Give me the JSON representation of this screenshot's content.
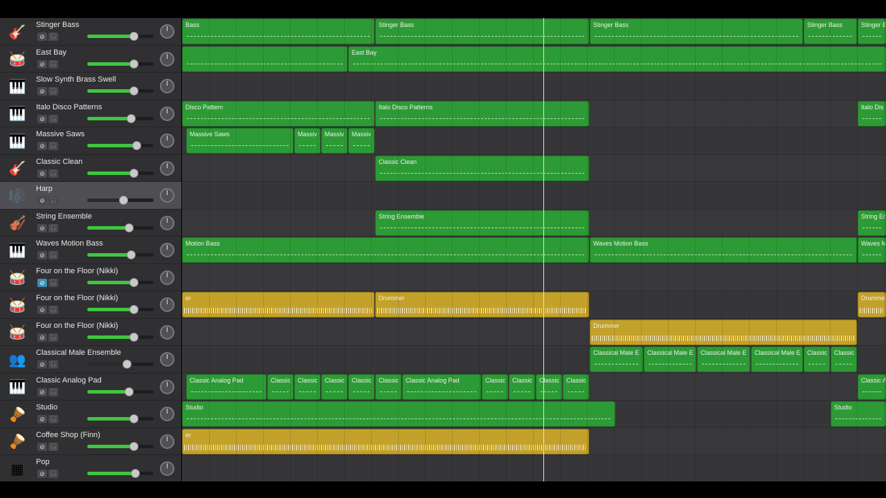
{
  "tracks": [
    {
      "name": "Stinger Bass",
      "icon": "bass-guitar-icon",
      "volume": 0.7,
      "mute": false
    },
    {
      "name": "East Bay",
      "icon": "drum-kit-icon",
      "volume": 0.7,
      "mute": false
    },
    {
      "name": "Slow Synth Brass Swell",
      "icon": "keyboard-icon",
      "volume": 0.7,
      "mute": false
    },
    {
      "name": "Italo Disco Patterns",
      "icon": "keyboard-stand-icon",
      "volume": 0.66,
      "mute": false
    },
    {
      "name": "Massive Saws",
      "icon": "keyboard-stand-icon",
      "volume": 0.74,
      "mute": false
    },
    {
      "name": "Classic Clean",
      "icon": "electric-guitar-icon",
      "volume": 0.7,
      "mute": false
    },
    {
      "name": "Harp",
      "icon": "harp-icon",
      "volume": 0.54,
      "mute": false,
      "selected": true
    },
    {
      "name": "String Ensemble",
      "icon": "violin-icon",
      "volume": 0.62,
      "mute": false
    },
    {
      "name": "Waves Motion Bass",
      "icon": "keyboard-stand-icon",
      "volume": 0.66,
      "mute": false
    },
    {
      "name": "Four on the Floor (Nikki)",
      "icon": "drum-machine-icon",
      "volume": 0.7,
      "mute": true
    },
    {
      "name": "Four on the Floor (Nikki)",
      "icon": "drum-machine-icon",
      "volume": 0.7,
      "mute": false
    },
    {
      "name": "Four on the Floor (Nikki)",
      "icon": "drum-machine-icon",
      "volume": 0.7,
      "mute": false
    },
    {
      "name": "Classical Male Ensemble",
      "icon": "choir-icon",
      "volume": 0.59,
      "mute": false
    },
    {
      "name": "Classic Analog Pad",
      "icon": "keyboard-stand-icon",
      "volume": 0.62,
      "mute": false
    },
    {
      "name": "Studio",
      "icon": "percussion-icon",
      "volume": 0.7,
      "mute": false
    },
    {
      "name": "Coffee Shop (Finn)",
      "icon": "percussion-icon",
      "volume": 0.7,
      "mute": false
    },
    {
      "name": "Pop",
      "icon": "drum-pad-icon",
      "volume": 0.72,
      "mute": false
    }
  ],
  "regions": [
    [
      {
        "label": "Bass",
        "kind": "green",
        "start": 0,
        "end": 278
      },
      {
        "label": "Stinger Bass",
        "kind": "green",
        "start": 279,
        "end": 588
      },
      {
        "label": "Stinger Bass",
        "kind": "green",
        "start": 589,
        "end": 897
      },
      {
        "label": "Stinger Bass",
        "kind": "green",
        "start": 898,
        "end": 975
      },
      {
        "label": "Stinger B",
        "kind": "green",
        "start": 976,
        "end": 1017
      }
    ],
    [
      {
        "label": "",
        "kind": "green",
        "start": 0,
        "end": 239
      },
      {
        "label": "East Bay",
        "kind": "green",
        "start": 240,
        "end": 1017
      }
    ],
    [],
    [
      {
        "label": "Disco Pattern",
        "kind": "green",
        "start": 0,
        "end": 278
      },
      {
        "label": "Italo Disco Patterns",
        "kind": "green",
        "start": 279,
        "end": 588
      },
      {
        "label": "Italo Dis",
        "kind": "green",
        "start": 976,
        "end": 1017
      }
    ],
    [
      {
        "label": "Massive Saws",
        "kind": "green",
        "start": 6,
        "end": 161
      },
      {
        "label": "Massiv",
        "kind": "green",
        "start": 162,
        "end": 200
      },
      {
        "label": "Massiv",
        "kind": "green",
        "start": 201,
        "end": 239
      },
      {
        "label": "Massiv",
        "kind": "green",
        "start": 240,
        "end": 278
      }
    ],
    [
      {
        "label": "Classic Clean",
        "kind": "green",
        "start": 279,
        "end": 588
      }
    ],
    [],
    [
      {
        "label": "String Ensemble",
        "kind": "green",
        "start": 279,
        "end": 588
      },
      {
        "label": "String En",
        "kind": "green",
        "start": 976,
        "end": 1017
      }
    ],
    [
      {
        "label": "Motion Bass",
        "kind": "green",
        "start": 0,
        "end": 588
      },
      {
        "label": "Waves Motion Bass",
        "kind": "green",
        "start": 589,
        "end": 975
      },
      {
        "label": "Waves Mo",
        "kind": "green",
        "start": 976,
        "end": 1017
      }
    ],
    [],
    [
      {
        "label": "er",
        "kind": "gold",
        "start": 0,
        "end": 278
      },
      {
        "label": "Drummer",
        "kind": "gold",
        "start": 279,
        "end": 588
      },
      {
        "label": "Drumme",
        "kind": "gold",
        "start": 976,
        "end": 1017
      }
    ],
    [
      {
        "label": "Drummer",
        "kind": "gold",
        "start": 589,
        "end": 975
      }
    ],
    [
      {
        "label": "Classical Male E",
        "kind": "green",
        "start": 589,
        "end": 666
      },
      {
        "label": "Classical Male E",
        "kind": "green",
        "start": 667,
        "end": 743
      },
      {
        "label": "Classical Male E",
        "kind": "green",
        "start": 744,
        "end": 821
      },
      {
        "label": "Classical Male E",
        "kind": "green",
        "start": 822,
        "end": 897
      },
      {
        "label": "Classic",
        "kind": "green",
        "start": 898,
        "end": 936
      },
      {
        "label": "Classic",
        "kind": "green",
        "start": 937,
        "end": 975
      }
    ],
    [
      {
        "label": "Classic Analog Pad",
        "kind": "green",
        "start": 6,
        "end": 122
      },
      {
        "label": "Classic",
        "kind": "green",
        "start": 123,
        "end": 161
      },
      {
        "label": "Classic",
        "kind": "green",
        "start": 162,
        "end": 200
      },
      {
        "label": "Classic",
        "kind": "green",
        "start": 201,
        "end": 239
      },
      {
        "label": "Classic",
        "kind": "green",
        "start": 240,
        "end": 278
      },
      {
        "label": "Classic",
        "kind": "green",
        "start": 279,
        "end": 317
      },
      {
        "label": "Classic Analog Pad",
        "kind": "green",
        "start": 318,
        "end": 432
      },
      {
        "label": "Classic",
        "kind": "green",
        "start": 433,
        "end": 471
      },
      {
        "label": "Classic",
        "kind": "green",
        "start": 472,
        "end": 510
      },
      {
        "label": "Classic",
        "kind": "green",
        "start": 511,
        "end": 549
      },
      {
        "label": "Classic",
        "kind": "green",
        "start": 550,
        "end": 588
      },
      {
        "label": "Classic A",
        "kind": "green",
        "start": 976,
        "end": 1017
      }
    ],
    [
      {
        "label": "Studio",
        "kind": "green",
        "start": 0,
        "end": 626
      },
      {
        "label": "Studio",
        "kind": "green",
        "start": 937,
        "end": 1017
      }
    ],
    [
      {
        "label": "er",
        "kind": "gold",
        "start": 0,
        "end": 588
      }
    ],
    []
  ]
}
